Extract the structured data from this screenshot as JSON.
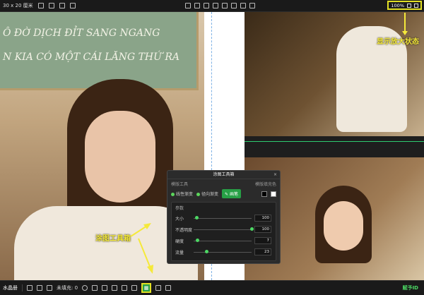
{
  "topbar": {
    "size_label": "30 x 20 厘米",
    "zoom_label": "100%",
    "icons": [
      "rotate-icon",
      "layers-icon",
      "grid-icon",
      "crop-icon",
      "align-left-icon",
      "align-center-icon",
      "align-right-icon",
      "align-top-icon",
      "align-middle-icon",
      "align-bottom-icon",
      "distribute-h-icon",
      "distribute-v-icon"
    ]
  },
  "chalkboard": {
    "line1": "Ô ĐỜ DỊCH ĐỈT SANG NGANG",
    "line2": "N KIA  CÓ MỘT CÁI LĂNG THỨ RA"
  },
  "annotations": {
    "zoom_note": "显示放大状态",
    "tool_note": "涂图工具箱"
  },
  "panel": {
    "title": "涂图工具箱",
    "close": "×",
    "tools_label": "模版工具",
    "fill_color_label": "模版填充色",
    "linear_label": "线性渐变",
    "radial_label": "径向渐变",
    "paint_label": "画笔",
    "params_label": "参数",
    "params": [
      {
        "label": "大小",
        "value": "100",
        "fraction": 0.05
      },
      {
        "label": "不透明度",
        "value": "100",
        "fraction": 1.0
      },
      {
        "label": "硬度",
        "value": "7",
        "fraction": 0.07
      },
      {
        "label": "流量",
        "value": "23",
        "fraction": 0.23
      }
    ]
  },
  "bottombar": {
    "name": "水晶册",
    "fill_label": "未填充: 0",
    "logo": "赋予ID"
  },
  "colors": {
    "accent_green": "#27a046",
    "highlight_yellow": "#e2e024",
    "annotation_yellow": "#f5e93a"
  }
}
